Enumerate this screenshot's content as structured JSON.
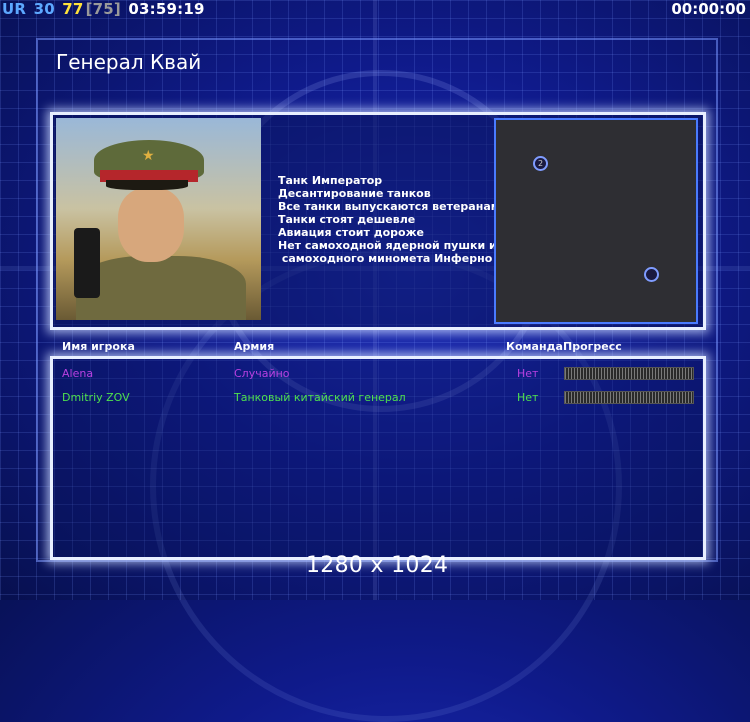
{
  "hud": {
    "left": [
      {
        "text": "UR",
        "color": "#5da8ff"
      },
      {
        "text": "30",
        "color": "#5da8ff"
      },
      {
        "text": "77",
        "color": "#ffe23a"
      },
      {
        "text": "[75]",
        "color": "#9a9a9a"
      },
      {
        "text": "03:59:19",
        "color": "#ffffff"
      }
    ],
    "timer": "00:00:00"
  },
  "general": {
    "title": "Генерал Квай",
    "traits": [
      "Танк Император",
      "Десантирование танков",
      "Все танки выпускаются ветеранами",
      "Танки стоят дешевле",
      "Авиация стоит дороже",
      "Нет самоходной ядерной пушки и",
      " самоходного миномета Инферно"
    ]
  },
  "minimap": {
    "slot_label": "2"
  },
  "players_table": {
    "headers": {
      "name": "Имя игрока",
      "army": "Армия",
      "team": "Команда",
      "progress": "Прогресс"
    },
    "rows": [
      {
        "name": "Alena",
        "army": "Случайно",
        "team": "Нет",
        "color": "#b840e0"
      },
      {
        "name": "Dmitriy ZOV",
        "army": "Танковый китайский генерал",
        "team": "Нет",
        "color": "#4ee04e"
      }
    ]
  },
  "resolution": "1280 x 1024"
}
